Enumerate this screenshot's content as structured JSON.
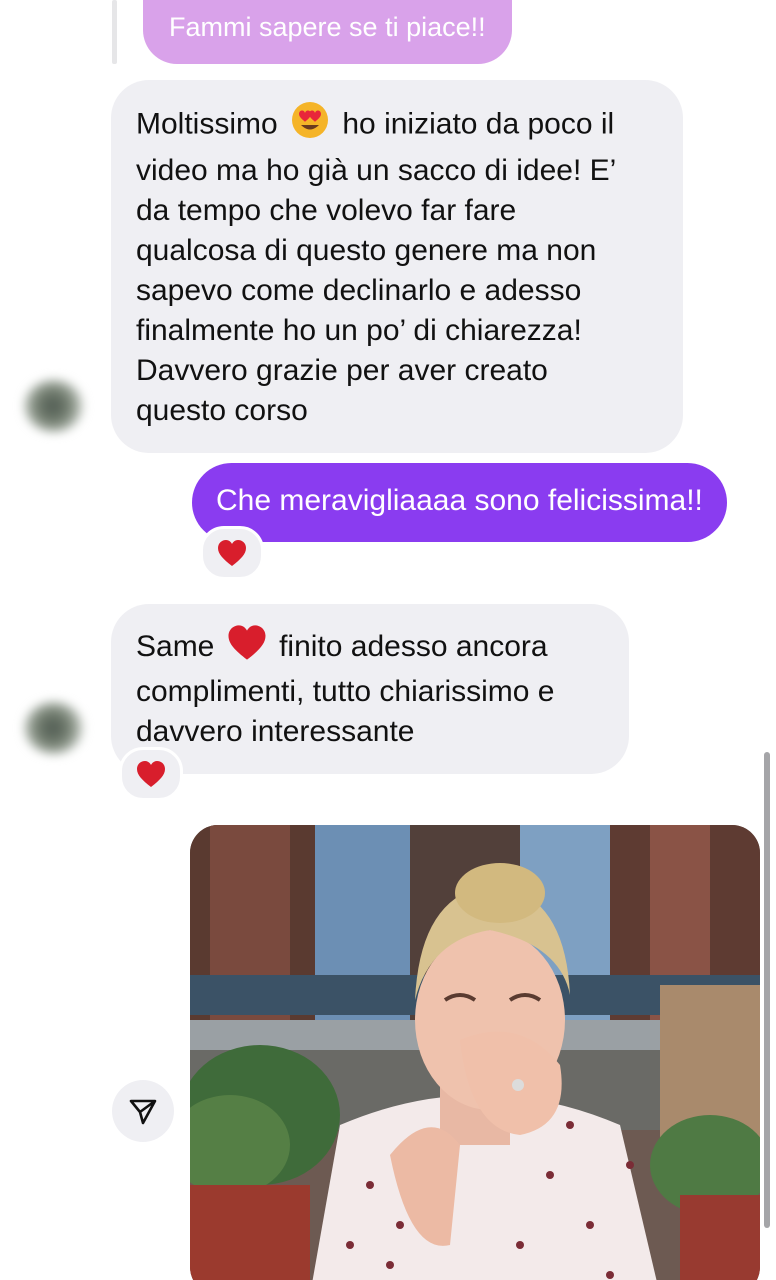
{
  "conversation": {
    "quoted_message": "Fammi sapere se ti piace!!",
    "incoming_1": {
      "lines": [
        {
          "before": "Moltissimo",
          "emoji": "heart-eyes-emoji",
          "after": "ho iniziato da poco il"
        },
        "video ma ho già un sacco di idee! E’",
        "da tempo che volevo far fare",
        "qualcosa di questo genere ma non",
        "sapevo come declinarlo e adesso",
        "finalmente ho un po’ di chiarezza!",
        "Davvero grazie per aver creato",
        "questo corso"
      ]
    },
    "outgoing_1": {
      "text": "Che meravigliaaaa sono felicissima!!",
      "reaction": "heart-emoji"
    },
    "incoming_2": {
      "lines": [
        {
          "before": "Same",
          "emoji": "heart-emoji",
          "after": "finito adesso ancora"
        },
        "complimenti, tutto chiarissimo e",
        "davvero interessante"
      ],
      "reaction": "heart-emoji"
    },
    "media": {
      "type": "gif",
      "description_icon": "image"
    },
    "share_icon": "paper-plane-icon"
  },
  "colors": {
    "outgoing_bubble": "#8a3cf0",
    "quoted_bubble": "#d9a2ea",
    "incoming_bubble": "#efeff3",
    "heart": "#d81e2c"
  }
}
